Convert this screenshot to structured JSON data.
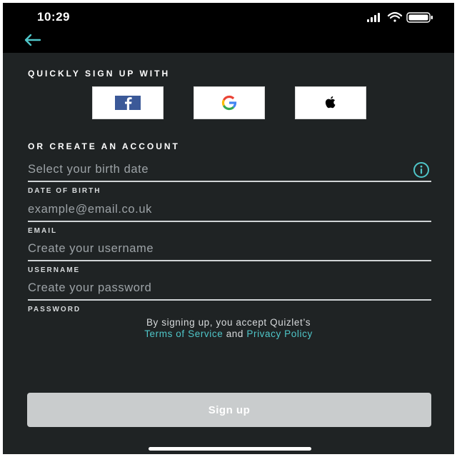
{
  "status_bar": {
    "time": "10:29",
    "icons": [
      "signal-icon",
      "wifi-icon",
      "battery-icon"
    ]
  },
  "nav": {
    "back_icon": "back-arrow-icon"
  },
  "social_signup": {
    "title": "QUICKLY SIGN UP WITH",
    "providers": [
      {
        "name": "Facebook",
        "icon": "facebook-icon",
        "color": "#3b5998"
      },
      {
        "name": "Google",
        "icon": "google-icon"
      },
      {
        "name": "Apple",
        "icon": "apple-icon",
        "color": "#000000"
      }
    ]
  },
  "create_account": {
    "title": "OR CREATE AN ACCOUNT",
    "fields": {
      "birth_date": {
        "placeholder": "Select your birth date",
        "value": "",
        "label": "DATE OF BIRTH",
        "icon": "info-icon"
      },
      "email": {
        "placeholder": "example@email.co.uk",
        "value": "",
        "label": "EMAIL"
      },
      "username": {
        "placeholder": "Create your username",
        "value": "",
        "label": "USERNAME"
      },
      "password": {
        "placeholder": "Create your password",
        "value": "",
        "label": "PASSWORD"
      }
    }
  },
  "terms": {
    "prefix": "By signing up, you accept Quizlet’s",
    "tos_link": "Terms of Service",
    "conjunction": "and",
    "privacy_link": "Privacy Policy"
  },
  "signup_button": {
    "label": "Sign up"
  },
  "colors": {
    "background": "#1f2324",
    "header": "#000000",
    "accent": "#4fc6c9",
    "button_disabled": "#c9cccd"
  }
}
